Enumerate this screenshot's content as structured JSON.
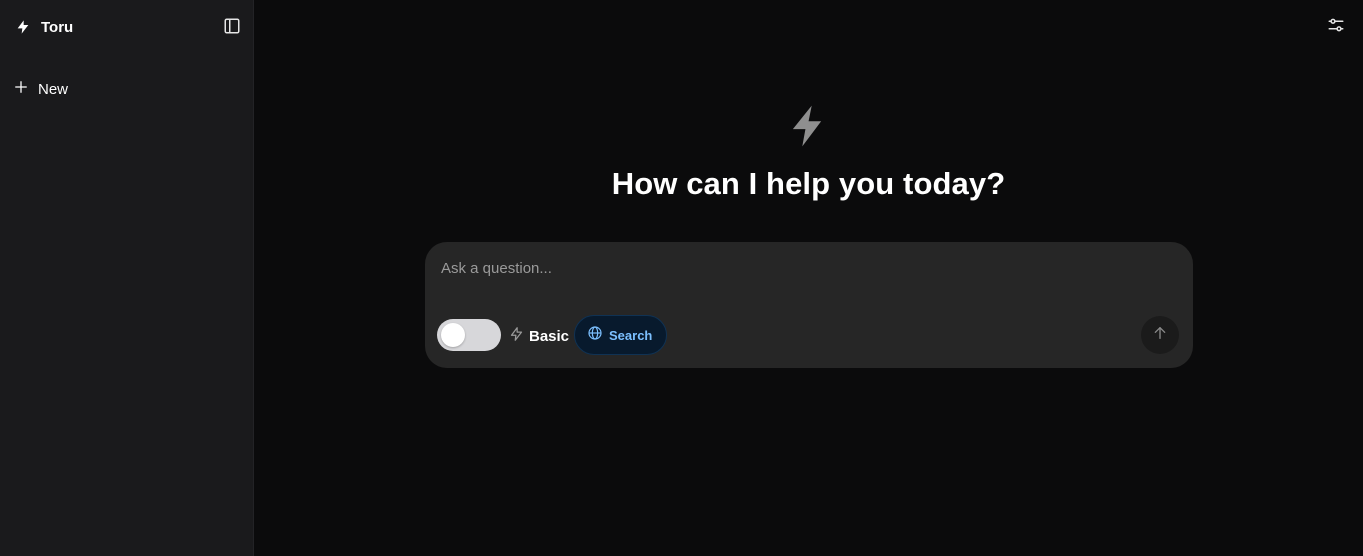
{
  "sidebar": {
    "brand": {
      "name": "Toru",
      "icon": "lightning-icon"
    },
    "toggle_icon": "sidebar-toggle-icon",
    "new_button": {
      "label": "New",
      "icon": "plus-icon"
    }
  },
  "header": {
    "settings_icon": "sliders-icon"
  },
  "main": {
    "hero_icon": "lightning-icon",
    "headline": "How can I help you today?"
  },
  "composer": {
    "placeholder": "Ask a question...",
    "mode_toggle": {
      "on": false
    },
    "mode": {
      "label": "Basic",
      "icon": "lightning-outline-icon"
    },
    "search_chip": {
      "label": "Search",
      "icon": "globe-icon",
      "active": true
    },
    "send_icon": "arrow-up-icon"
  },
  "colors": {
    "main_bg": "#0b0b0c",
    "sidebar_bg": "#1a1a1c",
    "composer_bg": "#262626",
    "accent_blue": "#7cc0ff",
    "chip_bg": "#081a2d"
  }
}
